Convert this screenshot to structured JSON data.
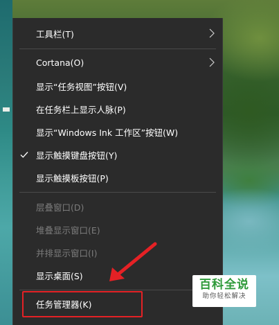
{
  "context_menu": {
    "items": [
      {
        "label": "工具栏(T)",
        "has_submenu": true,
        "checked": false,
        "enabled": true
      },
      {
        "label": "Cortana(O)",
        "has_submenu": true,
        "checked": false,
        "enabled": true
      },
      {
        "label": "显示“任务视图”按钮(V)",
        "has_submenu": false,
        "checked": false,
        "enabled": true
      },
      {
        "label": "在任务栏上显示人脉(P)",
        "has_submenu": false,
        "checked": false,
        "enabled": true
      },
      {
        "label": "显示“Windows Ink 工作区”按钮(W)",
        "has_submenu": false,
        "checked": false,
        "enabled": true
      },
      {
        "label": "显示触摸键盘按钮(Y)",
        "has_submenu": false,
        "checked": true,
        "enabled": true
      },
      {
        "label": "显示触摸板按钮(P)",
        "has_submenu": false,
        "checked": false,
        "enabled": true
      },
      {
        "label": "层叠窗口(D)",
        "has_submenu": false,
        "checked": false,
        "enabled": false
      },
      {
        "label": "堆叠显示窗口(E)",
        "has_submenu": false,
        "checked": false,
        "enabled": false
      },
      {
        "label": "并排显示窗口(I)",
        "has_submenu": false,
        "checked": false,
        "enabled": false
      },
      {
        "label": "显示桌面(S)",
        "has_submenu": false,
        "checked": false,
        "enabled": true
      },
      {
        "label": "任务管理器(K)",
        "has_submenu": false,
        "checked": false,
        "enabled": true
      }
    ],
    "icons": {
      "checkmark": "checkmark-icon",
      "submenu_arrow": "chevron-right-icon"
    }
  },
  "annotation": {
    "highlight_color": "#e52125",
    "arrow_icon": "red-arrow-icon"
  },
  "watermark": {
    "title": "百科全说",
    "subtitle": "助你轻松解决",
    "title_color": "#2f9a3a"
  },
  "colors": {
    "menu_background": "#2b2b2b",
    "menu_text": "#ffffff",
    "disabled_text": "#7c7c7c",
    "separator": "#4a4a4a"
  }
}
